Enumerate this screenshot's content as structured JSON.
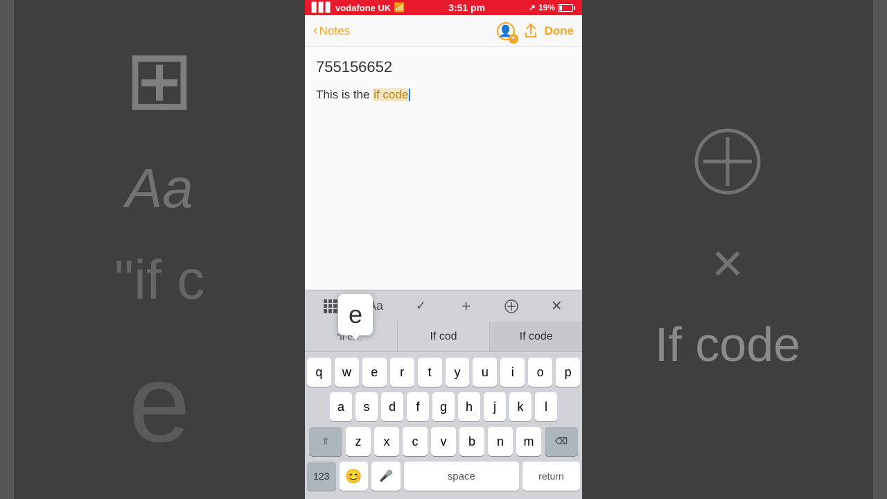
{
  "statusBar": {
    "carrier": "vodafone UK",
    "signal": "▋▋▋",
    "time": "3:51 pm",
    "location": "↗",
    "battery": "19%"
  },
  "navBar": {
    "backLabel": "Notes",
    "doneLabel": "Done",
    "shareIcon": "⬆",
    "collabIcon": "person"
  },
  "note": {
    "number": "755156652",
    "textBefore": "This is the ",
    "textHighlighted": "if code",
    "textAfter": ""
  },
  "toolbar": {
    "gridIcon": "grid",
    "aaIcon": "Aa",
    "checkIcon": "✓",
    "plusIcon": "+",
    "penIcon": "✏",
    "xIcon": "✕"
  },
  "autocorrect": {
    "items": [
      {
        "label": "\"if c…\"",
        "type": "quoted"
      },
      {
        "label": "If cod",
        "type": "normal"
      },
      {
        "label": "If code",
        "type": "selected"
      }
    ],
    "popupKey": "e"
  },
  "keyboard": {
    "rows": [
      [
        "q",
        "w",
        "e",
        "r",
        "t",
        "y",
        "u",
        "i",
        "o",
        "p"
      ],
      [
        "a",
        "s",
        "d",
        "f",
        "g",
        "h",
        "j",
        "k",
        "l"
      ],
      [
        "z",
        "x",
        "c",
        "v",
        "b",
        "n",
        "m"
      ],
      [
        "123",
        "😊",
        "🎤",
        "space",
        "return"
      ]
    ],
    "specialKeys": {
      "shift": "⇧",
      "delete": "⌫",
      "num": "123",
      "emoji": "😊",
      "mic": "🎤",
      "space": "space",
      "return": "return"
    }
  }
}
